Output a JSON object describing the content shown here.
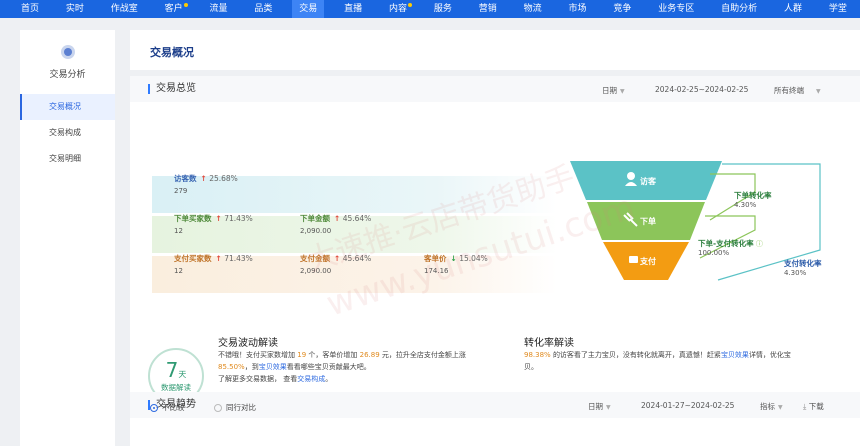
{
  "nav": {
    "items": [
      "首页",
      "实时",
      "作战室",
      "客户",
      "流量",
      "品类",
      "交易",
      "直播",
      "内容",
      "服务",
      "营销",
      "物流",
      "市场",
      "竞争",
      "业务专区",
      "自助分析",
      "人群",
      "学堂"
    ],
    "active": "交易"
  },
  "sidebar": {
    "title": "交易分析",
    "items": [
      "交易概况",
      "交易构成",
      "交易明细"
    ],
    "active": "交易概况"
  },
  "page_title": "交易概况",
  "overview": {
    "title": "交易总览",
    "date_label": "日期",
    "date_range": "2024-02-25~2024-02-25",
    "terminal": "所有终端",
    "visitors": {
      "label": "访客数",
      "change": "25.68%",
      "value": "279"
    },
    "order_buyers": {
      "label": "下单买家数",
      "change": "71.43%",
      "value": "12"
    },
    "order_amount": {
      "label": "下单金额",
      "change": "45.64%",
      "value": "2,090.00"
    },
    "pay_buyers": {
      "label": "支付买家数",
      "change": "71.43%",
      "value": "12"
    },
    "pay_amount": {
      "label": "支付金额",
      "change": "45.64%",
      "value": "2,090.00"
    },
    "unit_price": {
      "label": "客单价",
      "change": "15.04%",
      "value": "174.16"
    },
    "funnel": {
      "visit": "访客",
      "order": "下单",
      "pay": "支付"
    },
    "conversions": {
      "order_rate_label": "下单转化率",
      "order_rate": "4.30%",
      "order_to_pay_label": "下单-支付转化率",
      "order_to_pay": "100.00%",
      "pay_rate_label": "支付转化率",
      "pay_rate": "4.30%"
    },
    "badge": {
      "num": "7",
      "unit": "天",
      "sub": "数据解读"
    },
    "fluct": {
      "title": "交易波动解读",
      "p1": "不错哦！支付买家数增加",
      "n1": "19",
      "p2": "个，客单价增加",
      "n2": "26.89",
      "p3": "元，拉升全店支付金额上涨",
      "n3": "85.50%",
      "p4": "，到",
      "link1": "宝贝效果",
      "p5": "看看哪些宝贝贡献最大吧。",
      "p6": "了解更多交易数据，",
      "p7": "查看",
      "link2": "交易构成",
      "p8": "。"
    },
    "conv_interp": {
      "title": "转化率解读",
      "n1": "98.38%",
      "p1": "的访客看了主力宝贝，没有转化就离开，真遗憾！赶紧",
      "link1": "宝贝效果",
      "p2": "详情，优化宝贝。"
    }
  },
  "trend": {
    "title": "交易趋势",
    "date_label": "日期",
    "date_range": "2024-01-27~2024-02-25",
    "metric_label": "指标",
    "download": "下载",
    "radio1": "不比较",
    "radio2": "同行对比"
  },
  "watermark": {
    "cn": "大速推·云店带货助手",
    "en": "www.yunsutui.com"
  },
  "colors": {
    "nav_bg": "#1a66e0",
    "funnel_visit": "#5bc2c6",
    "funnel_order": "#8cc55a",
    "funnel_pay": "#f39c12"
  }
}
